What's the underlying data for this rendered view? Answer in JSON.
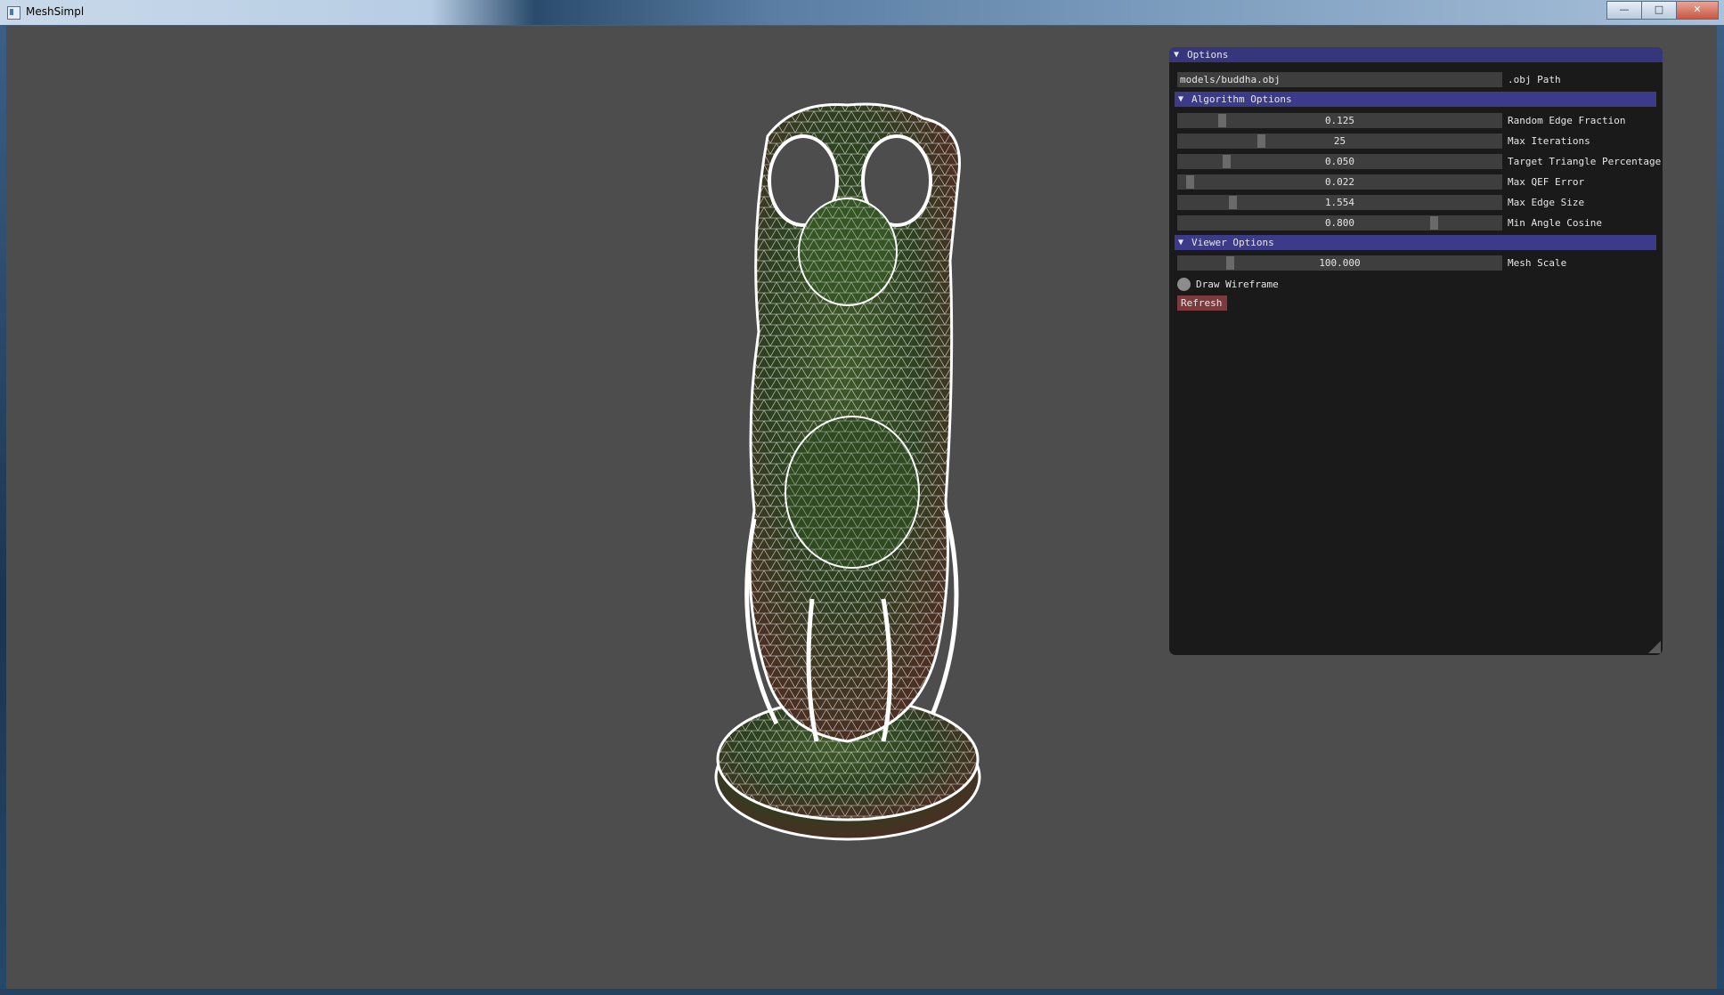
{
  "window": {
    "title": "MeshSimpl",
    "controls": {
      "minimize": "—",
      "maximize": "□",
      "close": "✕"
    }
  },
  "viewport": {
    "background": "#4d4d4d",
    "model_icon": "buddha-mesh-wireframe"
  },
  "panel": {
    "header": "Options",
    "path": {
      "value": "models/buddha.obj",
      "label": ".obj Path"
    },
    "algorithm": {
      "header": "Algorithm Options",
      "sliders": [
        {
          "value": "0.125",
          "label": "Random Edge Fraction",
          "fraction": 0.125
        },
        {
          "value": "25",
          "label": "Max Iterations",
          "fraction": 0.25
        },
        {
          "value": "0.050",
          "label": "Target Triangle Percentage",
          "fraction": 0.14
        },
        {
          "value": "0.022",
          "label": "Max QEF Error",
          "fraction": 0.022
        },
        {
          "value": "1.554",
          "label": "Max Edge Size",
          "fraction": 0.16
        },
        {
          "value": "0.800",
          "label": "Min Angle Cosine",
          "fraction": 0.8
        }
      ]
    },
    "viewer": {
      "header": "Viewer Options",
      "scale": {
        "value": "100.000",
        "label": "Mesh Scale",
        "fraction": 0.15
      },
      "wireframe_label": "Draw Wireframe",
      "refresh_label": "Refresh"
    }
  }
}
